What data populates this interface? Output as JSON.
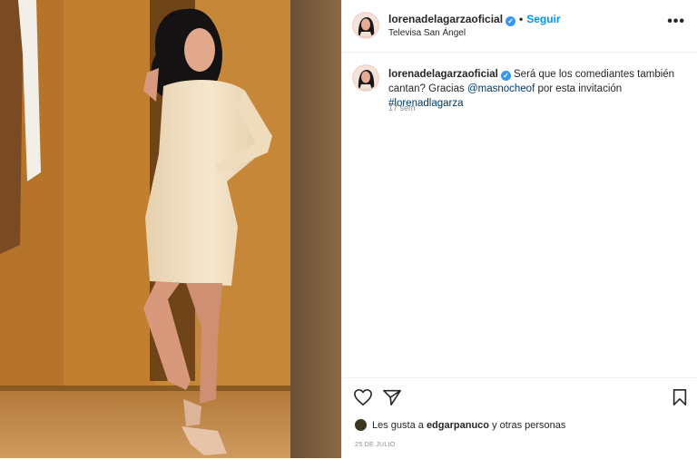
{
  "post": {
    "username": "lorenadelagarzaoficial",
    "follow_label": "Seguir",
    "location": "Televisa San Ángel",
    "caption_text": "Será que los comediantes también cantan? Gracias",
    "caption_mention": "@masnocheof",
    "caption_middle": "por esta invitación",
    "caption_hashtag": "#lorenadlagarza",
    "time_ago": "17 sem",
    "likes_prefix": "Les gusta a",
    "likes_user": "edgarpanuco",
    "likes_suffix": "y otras personas",
    "date": "25 DE JULIO"
  },
  "icons": {
    "verified": "verified-badge-icon",
    "more": "more-options-icon",
    "like": "heart-icon",
    "share": "share-icon",
    "save": "bookmark-icon"
  },
  "colors": {
    "link": "#0095f6",
    "mention": "#00376b",
    "verified": "#3897f0",
    "muted": "#8e8e8e"
  }
}
